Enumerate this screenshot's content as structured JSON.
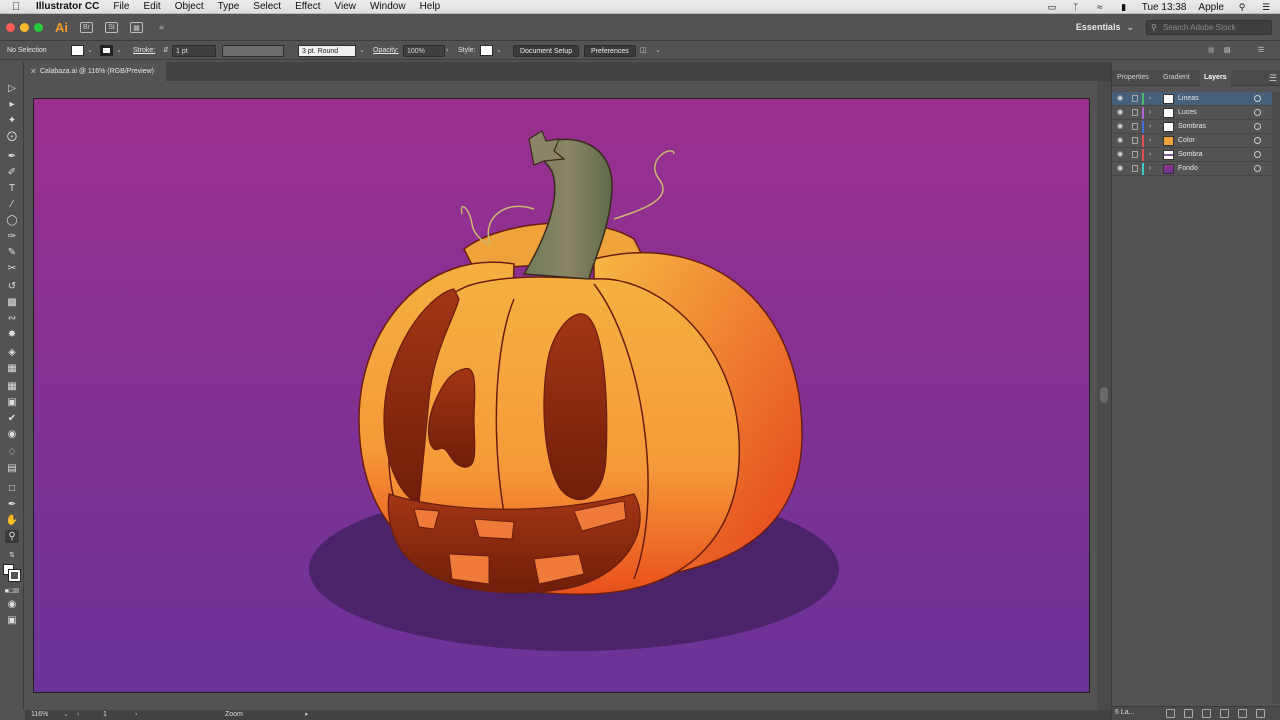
{
  "menubar": {
    "app_name": "Illustrator CC",
    "items": [
      "File",
      "Edit",
      "Object",
      "Type",
      "Select",
      "Effect",
      "View",
      "Window",
      "Help"
    ],
    "clock": "Tue 13:38",
    "user": "Apple"
  },
  "appbar": {
    "logo": "Ai",
    "workspace": "Essentials",
    "stock_placeholder": "Search Adobe Stock"
  },
  "controlbar": {
    "selection": "No Selection",
    "stroke_label": "Stroke:",
    "stroke_value": "1 pt",
    "brush": "3 pt. Round",
    "opacity_label": "Opacity:",
    "opacity_value": "100%",
    "style_label": "Style:",
    "document_setup": "Document Setup",
    "preferences": "Preferences"
  },
  "document": {
    "tab_title": "Calabaza.ai @ 116% (RGB/Preview)"
  },
  "statusbar": {
    "zoom": "116%",
    "artboard_number": "1",
    "tool_name": "Zoom"
  },
  "panel": {
    "tabs": [
      "Properties",
      "Gradient",
      "Layers"
    ],
    "active_tab": "Layers",
    "layers": [
      {
        "name": "Lineas",
        "color": "#4fb870",
        "selected": true
      },
      {
        "name": "Luces",
        "color": "#b463d0",
        "selected": false
      },
      {
        "name": "Sombras",
        "color": "#3f6fd8",
        "selected": false
      },
      {
        "name": "Color",
        "color": "#e05050",
        "selected": false
      },
      {
        "name": "Sombra",
        "color": "#e05050",
        "selected": false
      },
      {
        "name": "Fondo",
        "color": "#3fc8c8",
        "selected": false
      }
    ],
    "layer_count": "6 La..."
  },
  "colors": {
    "background_top": "#9a2f8e",
    "background_bottom": "#6a3398",
    "pumpkin_light": "#f5b040",
    "pumpkin_dark": "#e8501c",
    "stem": "#7a7a5a",
    "shadow": "#4a2368"
  }
}
